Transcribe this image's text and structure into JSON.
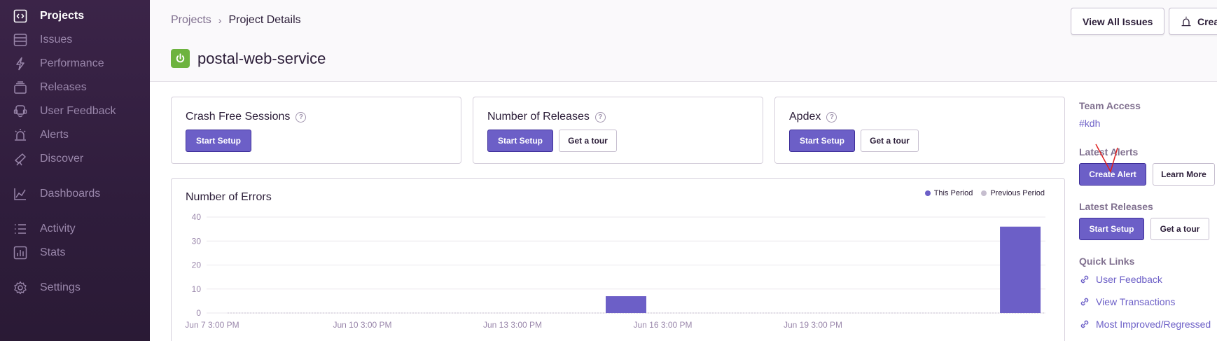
{
  "sidebar": {
    "items": [
      {
        "label": "Projects",
        "icon": "projects-icon",
        "active": true
      },
      {
        "label": "Issues",
        "icon": "issues-icon"
      },
      {
        "label": "Performance",
        "icon": "performance-icon"
      },
      {
        "label": "Releases",
        "icon": "releases-icon"
      },
      {
        "label": "User Feedback",
        "icon": "user-feedback-icon"
      },
      {
        "label": "Alerts",
        "icon": "alerts-icon"
      },
      {
        "label": "Discover",
        "icon": "discover-icon"
      },
      {
        "label": "Dashboards",
        "icon": "dashboards-icon"
      },
      {
        "label": "Activity",
        "icon": "activity-icon"
      },
      {
        "label": "Stats",
        "icon": "stats-icon"
      },
      {
        "label": "Settings",
        "icon": "settings-icon"
      }
    ]
  },
  "header": {
    "breadcrumb": {
      "root": "Projects",
      "current": "Project Details"
    },
    "project_name": "postal-web-service",
    "view_all_issues": "View All Issues",
    "create_label": "Crea"
  },
  "cards": {
    "crash_free": {
      "title": "Crash Free Sessions",
      "start_setup": "Start Setup"
    },
    "releases": {
      "title": "Number of Releases",
      "start_setup": "Start Setup",
      "get_tour": "Get a tour"
    },
    "apdex": {
      "title": "Apdex",
      "start_setup": "Start Setup",
      "get_tour": "Get a tour"
    }
  },
  "chart": {
    "legend_this": "This Period",
    "legend_prev": "Previous Period"
  },
  "chart_data": {
    "type": "bar",
    "title": "Number of Errors",
    "ylim": [
      0,
      40
    ],
    "yticks": [
      0,
      10,
      20,
      30,
      40
    ],
    "xtick_labels": [
      "Jun 7 3:00 PM",
      "Jun 10 3:00 PM",
      "Jun 13 3:00 PM",
      "Jun 16 3:00 PM",
      "Jun 19 3:00 PM"
    ],
    "series": [
      {
        "name": "This Period",
        "color": "#6c5fc7",
        "bars": [
          {
            "x_fraction": 0.5,
            "value": 7
          },
          {
            "x_fraction": 0.97,
            "value": 36
          }
        ]
      },
      {
        "name": "Previous Period",
        "color": "#c6becf",
        "bars": []
      }
    ]
  },
  "side": {
    "team_access": "Team Access",
    "team": "#kdh",
    "latest_alerts": "Latest Alerts",
    "create_alert": "Create Alert",
    "learn_more": "Learn More",
    "latest_releases": "Latest Releases",
    "start_setup": "Start Setup",
    "get_tour": "Get a tour",
    "quick_links": "Quick Links",
    "links": [
      "User Feedback",
      "View Transactions",
      "Most Improved/Regressed"
    ]
  },
  "colors": {
    "accent": "#6c5fc7",
    "sidebar": "#2f1d3c",
    "spring_green": "#6db33f"
  }
}
